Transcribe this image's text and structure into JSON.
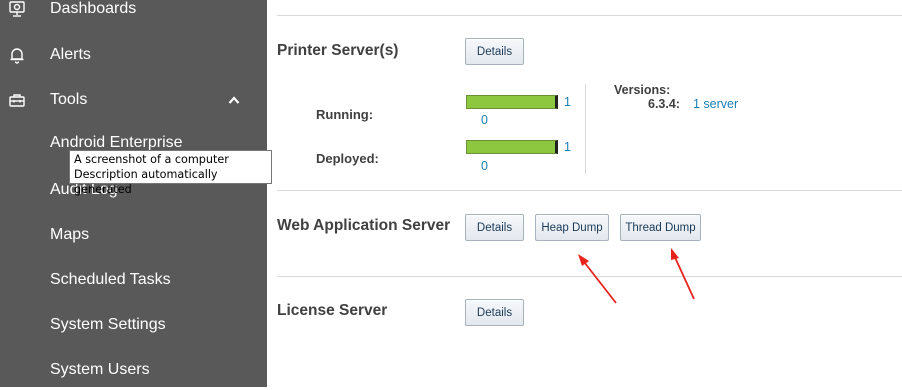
{
  "sidebar": {
    "items": [
      {
        "label": "Dashboards",
        "icon": "dashboard-icon"
      },
      {
        "label": "Alerts",
        "icon": "bell-icon"
      },
      {
        "label": "Tools",
        "icon": "toolbox-icon",
        "expanded": true,
        "chevron": "chevron-up-icon"
      }
    ],
    "subitems": [
      {
        "label": "Android Enterprise"
      },
      {
        "label": "Audit Log"
      },
      {
        "label": "Maps"
      },
      {
        "label": "Scheduled Tasks"
      },
      {
        "label": "System Settings"
      },
      {
        "label": "System Users"
      }
    ]
  },
  "tooltip": {
    "line1": "A screenshot of a computer",
    "line2": "Description automatically generated"
  },
  "printer_server": {
    "title": "Printer Server(s)",
    "details_label": "Details",
    "running_label": "Running:",
    "running_total": "1",
    "running_value": "0",
    "running_fraction": 1.0,
    "deployed_label": "Deployed:",
    "deployed_total": "1",
    "deployed_value": "0",
    "deployed_fraction": 1.0,
    "versions_title": "Versions:",
    "version_number": "6.3.4:",
    "version_link": "1 server"
  },
  "web_app_server": {
    "title": "Web Application Server",
    "details_label": "Details",
    "heap_dump_label": "Heap Dump",
    "thread_dump_label": "Thread Dump"
  },
  "license_server": {
    "title": "License Server",
    "details_label": "Details"
  },
  "colors": {
    "sidebar_bg": "#595959",
    "bar_green": "#8dc63f",
    "link_blue": "#1a7fb4",
    "annotation_red": "#e8231c"
  }
}
